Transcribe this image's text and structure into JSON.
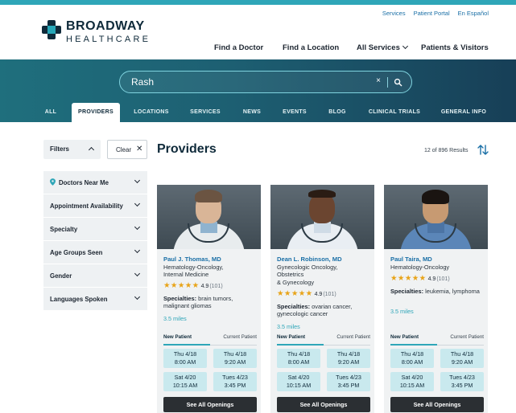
{
  "header": {
    "logo_name": "BROADWAY",
    "logo_sub": "HEALTHCARE",
    "util_links": [
      "Services",
      "Patient Portal",
      "En Español"
    ],
    "nav": {
      "find_doctor": "Find a Doctor",
      "find_location": "Find a Location",
      "all_services": "All Services",
      "patients_visitors": "Patients & Visitors"
    }
  },
  "search": {
    "value": "Rash",
    "clear": "×"
  },
  "tabs": [
    "ALL",
    "PROVIDERS",
    "LOCATIONS",
    "SERVICES",
    "NEWS",
    "EVENTS",
    "BLOG",
    "CLINICAL TRIALS",
    "GENERAL INFO"
  ],
  "active_tab": "PROVIDERS",
  "filters": {
    "toggle_label": "Filters",
    "clear_label": "Clear",
    "items": [
      "Doctors Near Me",
      "Appointment Availability",
      "Specialty",
      "Age Groups Seen",
      "Gender",
      "Languages Spoken"
    ]
  },
  "results": {
    "title": "Providers",
    "count": "12 of 896 Results"
  },
  "providers": [
    {
      "name": "Paul J. Thomas, MD",
      "specialty_lines": [
        "Hematology-Oncology,",
        "Internal Medicine"
      ],
      "stars": "★★★★★",
      "rating": "4.9",
      "review_count": "(101)",
      "specialties_label": "Specialties:",
      "specialties": "brain tumors, malignant gliomas",
      "distance": "3.5 miles",
      "tab_new": "New Patient",
      "tab_current": "Current Patient",
      "slots": [
        [
          "Thu 4/18",
          "8:00 AM"
        ],
        [
          "Thu 4/18",
          "9:20 AM"
        ],
        [
          "Sat 4/20",
          "10:15 AM"
        ],
        [
          "Tues 4/23",
          "3:45 PM"
        ]
      ],
      "button": "See All Openings"
    },
    {
      "name": "Dean L. Robinson, MD",
      "specialty_lines": [
        "Gynecologic Oncology,",
        "Obstetrics",
        "& Gynecology"
      ],
      "stars": "★★★★★",
      "rating": "4.9",
      "review_count": "(101)",
      "specialties_label": "Specialties:",
      "specialties": "ovarian cancer, gynecologic cancer",
      "distance": "3.5 miles",
      "tab_new": "New Patient",
      "tab_current": "Current Patient",
      "slots": [
        [
          "Thu 4/18",
          "8:00 AM"
        ],
        [
          "Thu 4/18",
          "9:20 AM"
        ],
        [
          "Sat 4/20",
          "10:15 AM"
        ],
        [
          "Tues 4/23",
          "3:45 PM"
        ]
      ],
      "button": "See All Openings"
    },
    {
      "name": "Paul Taira, MD",
      "specialty_lines": [
        "Hematology-Oncology"
      ],
      "stars": "★★★★★",
      "rating": "4.9",
      "review_count": "(101)",
      "specialties_label": "Specialties:",
      "specialties": "leukemia, lymphoma",
      "distance": "3.5 miles",
      "tab_new": "New Patient",
      "tab_current": "Current Patient",
      "slots": [
        [
          "Thu 4/18",
          "8:00 AM"
        ],
        [
          "Thu 4/18",
          "9:20 AM"
        ],
        [
          "Sat 4/20",
          "10:15 AM"
        ],
        [
          "Tues 4/23",
          "3:45 PM"
        ]
      ],
      "button": "See All Openings"
    }
  ],
  "colors": {
    "accent": "#2fa6b8",
    "brand_dark": "#0f2a3a",
    "link": "#1a6fa6",
    "star": "#e8a317",
    "slot": "#c9e9ee",
    "button": "#2b2f33"
  }
}
